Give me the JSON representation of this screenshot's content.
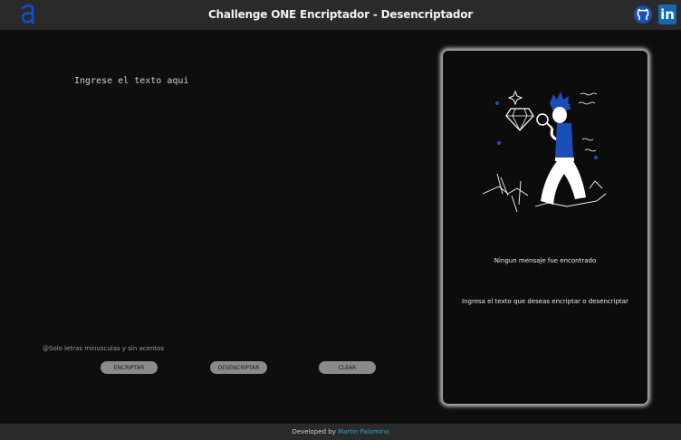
{
  "header": {
    "title": "Challenge ONE Encriptador - Desencriptador",
    "logo_icon": "alura-logo-icon",
    "github_icon": "github-icon",
    "linkedin_label": "in"
  },
  "input": {
    "placeholder": "Ingrese el texto aqui",
    "value": ""
  },
  "hint": "@Solo letras minusculas y sin acentos",
  "buttons": {
    "encrypt": "ENCRIPTAR",
    "decrypt": "DESENCRIPTAR",
    "clear": "CLEAR"
  },
  "output_panel": {
    "illustration_icon": "person-with-magnifier-and-diamond-illustration",
    "title": "Ningun mensaje fue encontrado",
    "body": "Ingresa el texto que deseas encriptar o desencriptar"
  },
  "footer": {
    "prefix": "Developed by ",
    "author": "Martin Palomino"
  },
  "colors": {
    "background": "#0e0e0e",
    "bar": "#2a2a2a",
    "button": "#8a8a8a",
    "accent_blue": "#0a3a9a",
    "link": "#2ba3c7"
  }
}
